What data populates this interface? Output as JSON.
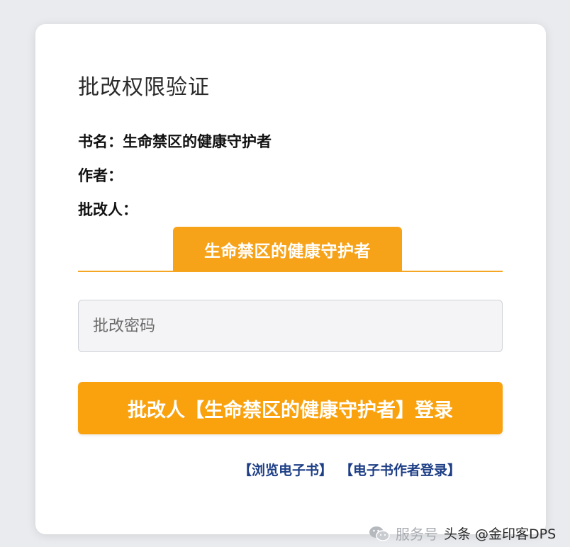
{
  "page": {
    "title": "批改权限验证"
  },
  "info": {
    "book_label": "书名：生命禁区的健康守护者",
    "author_label": "作者：",
    "reviewer_label": "批改人："
  },
  "tab": {
    "label": "生命禁区的健康守护者"
  },
  "form": {
    "password_placeholder": "批改密码",
    "password_value": "",
    "login_button": "批改人【生命禁区的健康守护者】登录"
  },
  "links": {
    "browse": "【浏览电子书】",
    "author_login": "【电子书作者登录】"
  },
  "watermark": {
    "icon": "wechat-icon",
    "source": "服务号",
    "credit": "头条 @金印客DPS"
  },
  "colors": {
    "accent": "#f9a20e",
    "link": "#1e3f86",
    "background": "#e9ebee"
  }
}
